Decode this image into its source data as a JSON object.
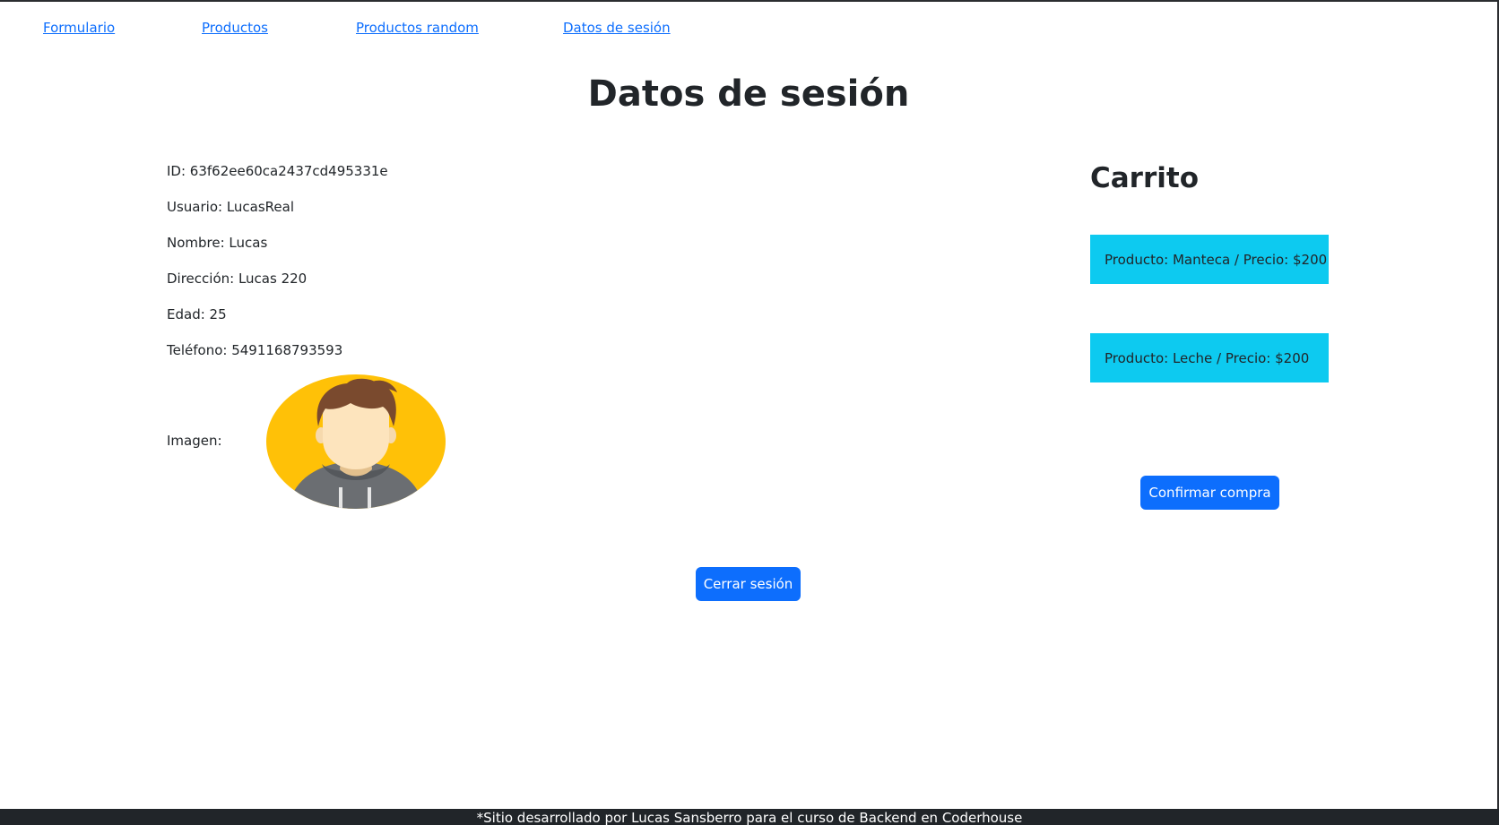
{
  "nav": {
    "links": [
      {
        "label": "Formulario"
      },
      {
        "label": "Productos"
      },
      {
        "label": "Productos random"
      },
      {
        "label": "Datos de sesión"
      }
    ]
  },
  "main": {
    "title": "Datos de sesión",
    "user": {
      "id": "ID: 63f62ee60ca2437cd495331e",
      "username": "Usuario: LucasReal",
      "name": "Nombre: Lucas",
      "address": "Dirección: Lucas 220",
      "age": "Edad: 25",
      "phone": "Teléfono: 5491168793593",
      "image_label": "Imagen:"
    },
    "logout_label": "Cerrar sesión"
  },
  "cart": {
    "title": "Carrito",
    "items": [
      {
        "text": "Producto: Manteca / Precio: $200"
      },
      {
        "text": "Producto: Leche / Precio: $200"
      }
    ],
    "confirm_label": "Confirmar compra"
  },
  "footer": {
    "text": "*Sitio desarrollado por Lucas Sansberro para el curso de Backend en Coderhouse"
  },
  "colors": {
    "link": "#0d6efd",
    "primary_button": "#0d6efd",
    "cart_item_bg": "#0dcaf0",
    "footer_bg": "#212529",
    "avatar_bg": "#ffc107"
  },
  "icons": {
    "avatar": "user-avatar-icon"
  }
}
